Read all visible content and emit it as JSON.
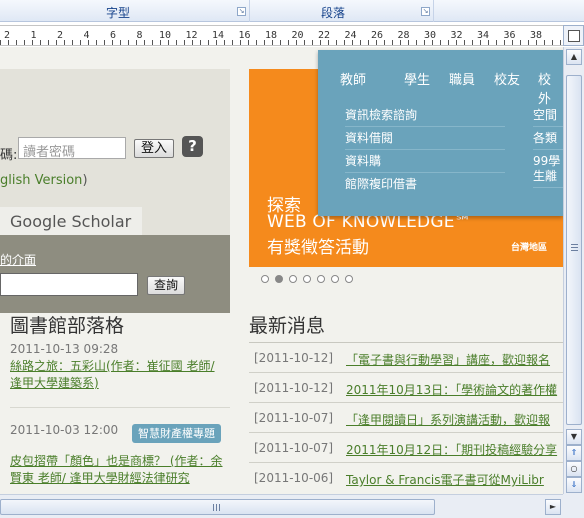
{
  "ribbon": {
    "groups": [
      {
        "label": "字型"
      },
      {
        "label": "段落"
      }
    ]
  },
  "ruler": {
    "numbers": [
      "2",
      "1",
      "2",
      "4",
      "6",
      "8",
      "10",
      "12",
      "14",
      "16",
      "18",
      "20",
      "22",
      "24",
      "26",
      "28",
      "30",
      "32",
      "34",
      "36",
      "38"
    ]
  },
  "login": {
    "password_label": "碼:",
    "password_placeholder": "讀者密碼",
    "login_button": "登入",
    "help_icon": "?",
    "english_link": "glish Version",
    "english_paren": ")"
  },
  "search": {
    "tab_label": "Google Scholar",
    "interface_link": "的介面",
    "search_button": "查詢"
  },
  "menu": {
    "tabs": [
      "教師",
      "學生",
      "職員",
      "校友",
      "校外"
    ],
    "items_left": [
      "資訊檢索諮詢",
      "資料借閱",
      "資料購",
      "館際複印借書"
    ],
    "items_right": [
      "空間",
      "各類",
      "99學",
      "生離"
    ]
  },
  "banner": {
    "line1": "探索",
    "line2": "WEB OF KNOWLEDGE℠",
    "line3": "有獎徵答活動",
    "region": "台灣地區"
  },
  "carousel": {
    "active_index": 1,
    "count": 7
  },
  "blog": {
    "heading": "圖書館部落格",
    "entries": [
      {
        "date": "2011-10-13 09:28",
        "title": "絲路之旅：五彩山(作者：崔征國 老師/ 逢甲大學建築系)"
      },
      {
        "date": "2011-10-03 12:00",
        "title": "皮包摺帶「顏色」也是商標？ (作者：余賢東 老師/ 逢甲大學財經法律研究",
        "tag": "智慧財產權專題"
      }
    ]
  },
  "news": {
    "heading": "最新消息",
    "items": [
      {
        "date": "[2011-10-12]",
        "title": "「電子書與行動學習」講座，歡迎報名"
      },
      {
        "date": "[2011-10-12]",
        "title": "2011年10月13日：「學術論文的著作權"
      },
      {
        "date": "[2011-10-07]",
        "title": "「逢甲閱讀日」系列演講活動，歡迎報"
      },
      {
        "date": "[2011-10-07]",
        "title": "2011年10月12日：「期刊投稿經驗分享"
      },
      {
        "date": "[2011-10-06]",
        "title": "Taylor & Francis電子書可從MyiLibr"
      }
    ]
  },
  "colors": {
    "accent_teal": "#6aa3bb",
    "banner_orange": "#f58a1c",
    "link_green": "#4a7e2a"
  }
}
